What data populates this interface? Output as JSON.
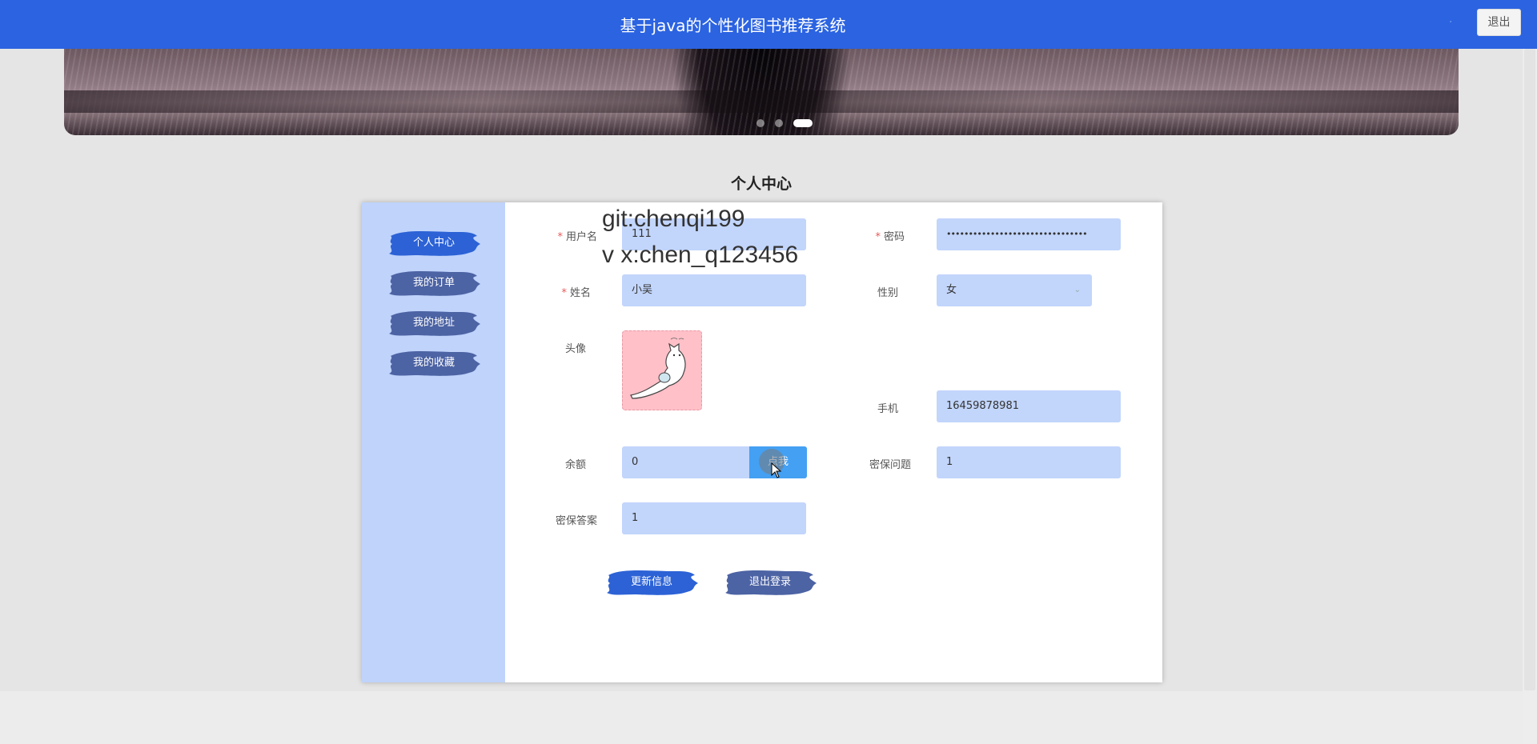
{
  "header": {
    "title": "基于java的个性化图书推荐系统",
    "logout_label": "退出"
  },
  "colors": {
    "primary": "#2b63e1",
    "sidebar_bg": "#bfd3fb",
    "field_bg": "#c2d5fb",
    "brush_active": "#2c62d6",
    "brush_inactive": "#4c63a4"
  },
  "banner": {
    "carousel_dots": 3,
    "active_dot": 3
  },
  "section_title": "个人中心",
  "sidebar": {
    "items": [
      {
        "label": "个人中心",
        "active": true
      },
      {
        "label": "我的订单",
        "active": false
      },
      {
        "label": "我的地址",
        "active": false
      },
      {
        "label": "我的收藏",
        "active": false
      }
    ]
  },
  "form": {
    "username": {
      "label": "用户名",
      "value": "111",
      "required": true
    },
    "password": {
      "label": "密码",
      "value": "••••••••••••••••••••••••••••••••",
      "required": true
    },
    "name": {
      "label": "姓名",
      "value": "小吴",
      "required": true
    },
    "gender": {
      "label": "性别",
      "value": "女"
    },
    "avatar": {
      "label": "头像"
    },
    "phone": {
      "label": "手机",
      "value": "16459878981"
    },
    "balance": {
      "label": "余额",
      "value": "0",
      "recharge_label": "点我"
    },
    "security_question": {
      "label": "密保问题",
      "value": "1"
    },
    "security_answer": {
      "label": "密保答案",
      "value": "1"
    }
  },
  "actions": {
    "update_label": "更新信息",
    "logout_label": "退出登录"
  },
  "watermark": {
    "line1": "git:chenqi199",
    "line2": "v x:chen_q123456"
  }
}
